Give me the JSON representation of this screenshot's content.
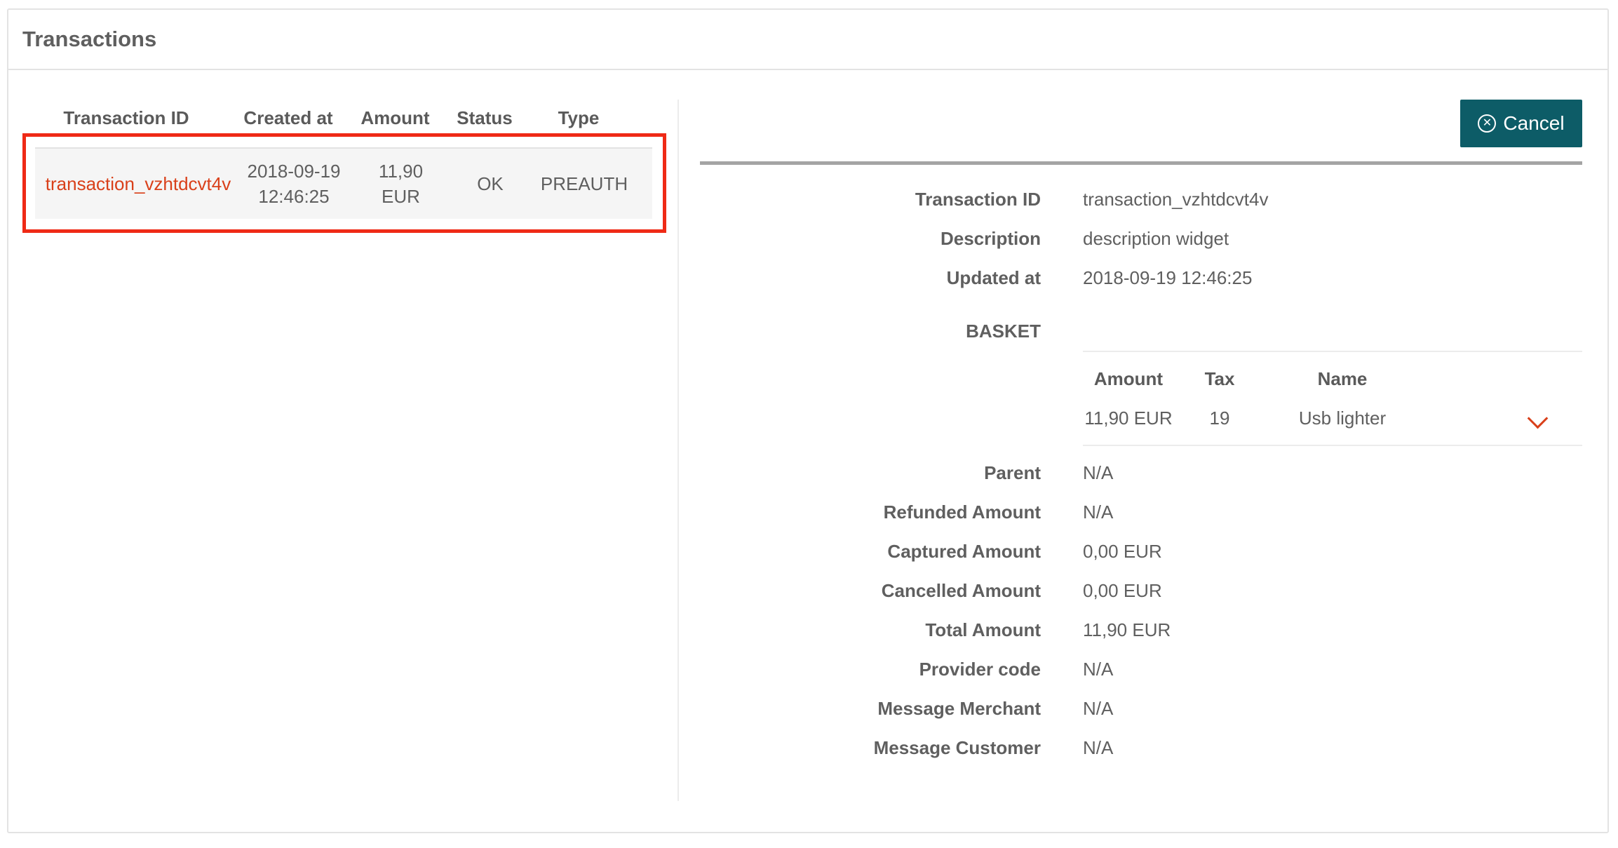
{
  "panel": {
    "title": "Transactions"
  },
  "list": {
    "columns": [
      "Transaction ID",
      "Created at",
      "Amount",
      "Status",
      "Type"
    ],
    "rows": [
      {
        "transaction_id": "transaction_vzhtdcvt4v",
        "created_date": "2018-09-19",
        "created_time": "12:46:25",
        "amount_value": "11,90",
        "amount_currency": "EUR",
        "status": "OK",
        "type": "PREAUTH"
      }
    ]
  },
  "detail": {
    "cancel_label": "Cancel",
    "fields_top": [
      {
        "label": "Transaction ID",
        "value": "transaction_vzhtdcvt4v"
      },
      {
        "label": "Description",
        "value": "description widget"
      },
      {
        "label": "Updated at",
        "value": "2018-09-19 12:46:25"
      }
    ],
    "basket": {
      "label": "BASKET",
      "columns": [
        "Amount",
        "Tax",
        "Name"
      ],
      "items": [
        {
          "amount": "11,90 EUR",
          "tax": "19",
          "name": "Usb lighter"
        }
      ]
    },
    "fields_bottom": [
      {
        "label": "Parent",
        "value": "N/A"
      },
      {
        "label": "Refunded Amount",
        "value": "N/A"
      },
      {
        "label": "Captured Amount",
        "value": "0,00 EUR"
      },
      {
        "label": "Cancelled Amount",
        "value": "0,00 EUR"
      },
      {
        "label": "Total Amount",
        "value": "11,90 EUR"
      },
      {
        "label": "Provider code",
        "value": "N/A"
      },
      {
        "label": "Message Merchant",
        "value": "N/A"
      },
      {
        "label": "Message Customer",
        "value": "N/A"
      }
    ]
  },
  "colors": {
    "accent_link": "#d9401a",
    "highlight_box": "#ef2a16",
    "cancel_button": "#0d5c67"
  },
  "icons": {
    "cancel": "circle-x-icon",
    "expand": "chevron-down-icon"
  }
}
